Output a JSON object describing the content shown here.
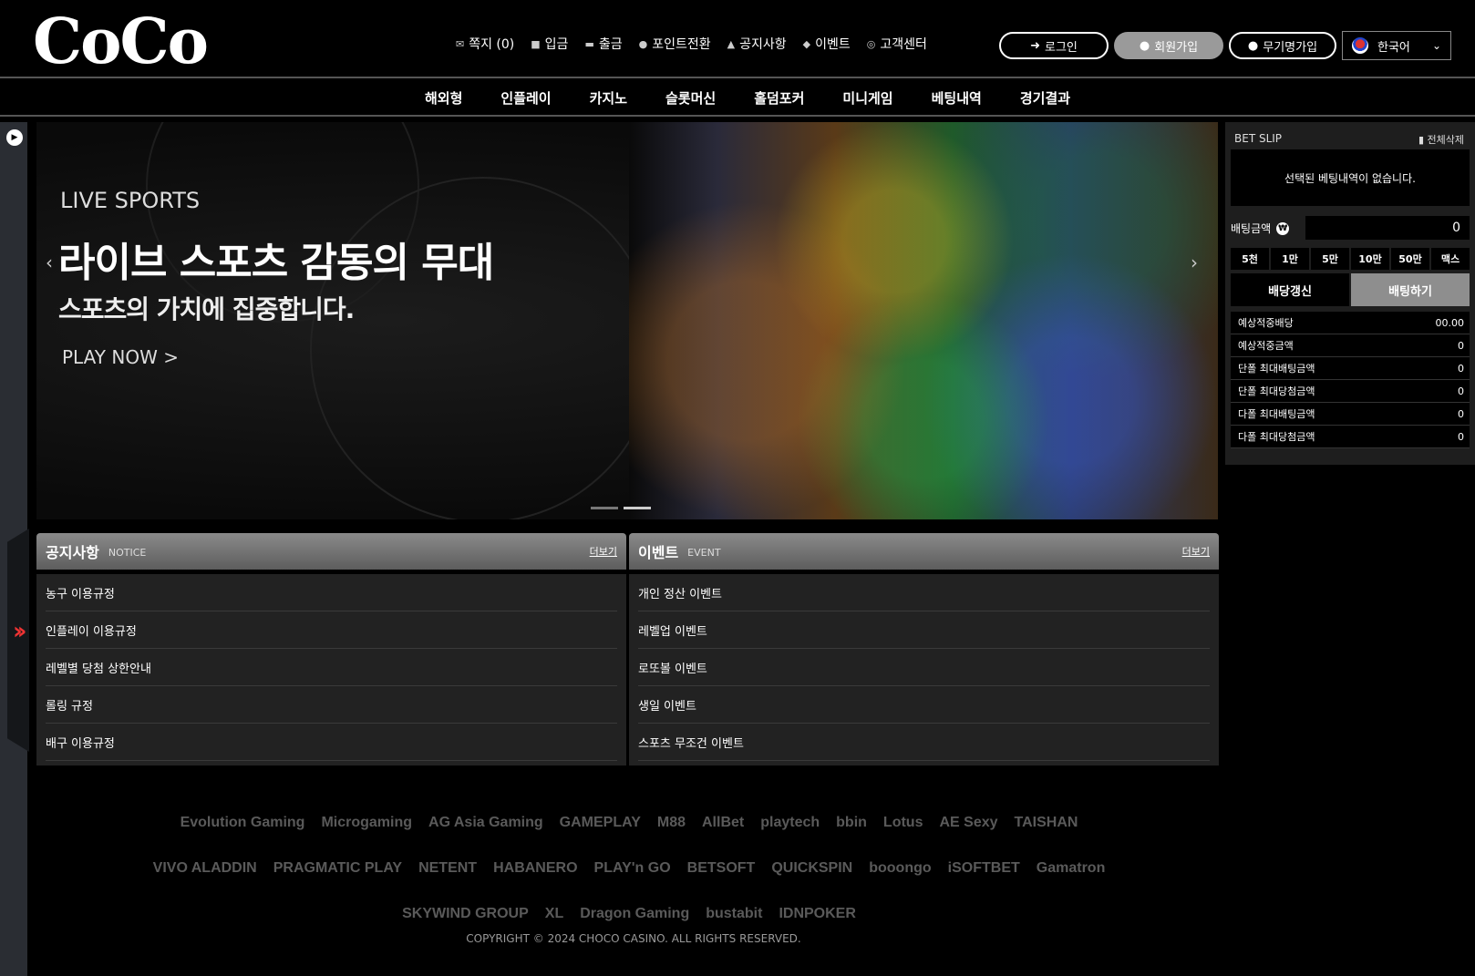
{
  "logo": "CoCo",
  "topnav": [
    {
      "icon": "✉",
      "label": "쪽지 (0)"
    },
    {
      "icon": "■",
      "label": "입금"
    },
    {
      "icon": "▬",
      "label": "출금"
    },
    {
      "icon": "●",
      "label": "포인트전환"
    },
    {
      "icon": "▲",
      "label": "공지사항"
    },
    {
      "icon": "◆",
      "label": "이벤트"
    },
    {
      "icon": "◎",
      "label": "고객센터"
    }
  ],
  "auth": {
    "login": "로그인",
    "join": "회원가입",
    "nojoin": "무기명가입"
  },
  "lang": {
    "selected": "한국어"
  },
  "mainnav": [
    "해외형",
    "인플레이",
    "카지노",
    "슬롯머신",
    "홀덤포커",
    "미니게임",
    "베팅내역",
    "경기결과"
  ],
  "banner": {
    "sub": "LIVE SPORTS",
    "title": "라이브 스포츠 감동의 무대",
    "desc": "스포츠의 가치에 집중합니다.",
    "cta": "PLAY NOW >"
  },
  "betslip": {
    "title": "BET SLIP",
    "clear": "전체삭제",
    "empty": "선택된 베팅내역이 없습니다.",
    "amount_label": "배팅금액",
    "amount_value": "0",
    "chips": [
      "5천",
      "1만",
      "5만",
      "10만",
      "50만",
      "맥스"
    ],
    "refresh": "배당갱신",
    "place": "배팅하기",
    "rows": [
      {
        "label": "예상적중배당",
        "value": "00.00"
      },
      {
        "label": "예상적중금액",
        "value": "0"
      },
      {
        "label": "단폴 최대배팅금액",
        "value": "0"
      },
      {
        "label": "단폴 최대당첨금액",
        "value": "0"
      },
      {
        "label": "다폴 최대배팅금액",
        "value": "0"
      },
      {
        "label": "다폴 최대당첨금액",
        "value": "0"
      }
    ]
  },
  "notice": {
    "title": "공지사항",
    "en": "NOTICE",
    "more": "더보기",
    "items": [
      "농구 이용규정",
      "인플레이 이용규정",
      "레벨별 당첨 상한안내",
      "롤링 규정",
      "배구 이용규정"
    ]
  },
  "event": {
    "title": "이벤트",
    "en": "EVENT",
    "more": "더보기",
    "items": [
      "개인 정산 이벤트",
      "레벨업 이벤트",
      "로또볼 이벤트",
      "생일 이벤트",
      "스포츠 무조건 이벤트"
    ]
  },
  "providers": [
    [
      "Evolution Gaming",
      "Microgaming",
      "AG Asia Gaming",
      "GAMEPLAY",
      "M88",
      "AllBet",
      "playtech",
      "bbin",
      "Lotus",
      "AE Sexy",
      "TAISHAN"
    ],
    [
      "VIVO ALADDIN",
      "PRAGMATIC PLAY",
      "NETENT",
      "HABANERO",
      "PLAY'n GO",
      "BETSOFT",
      "QUICKSPIN",
      "booongo",
      "iSOFTBET",
      "Gamatron"
    ],
    [
      "SKYWIND GROUP",
      "XL",
      "Dragon Gaming",
      "bustabit",
      "IDNPOKER"
    ]
  ],
  "copyright": "COPYRIGHT © 2024 CHOCO CASINO. ALL RIGHTS RESERVED."
}
